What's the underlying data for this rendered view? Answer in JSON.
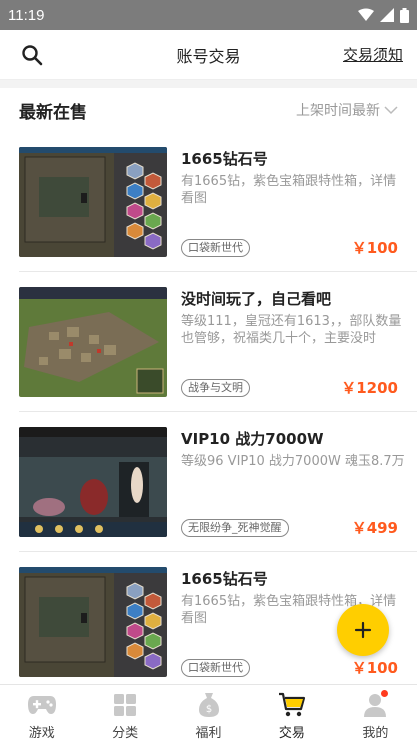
{
  "status_bar": {
    "time": "11:19"
  },
  "header": {
    "title": "账号交易",
    "rules_link": "交易须知"
  },
  "section": {
    "title": "最新在售",
    "sort_label": "上架时间最新"
  },
  "listings": [
    {
      "title": "1665钻石号",
      "description": "有1665钻，紫色宝箱跟特性箱，详情看图",
      "tag": "口袋新世代",
      "price": "￥100",
      "thumb": "hex"
    },
    {
      "title": "没时间玩了，自己看吧",
      "description": "等级111，皇冠还有1613，，部队数量也管够，祝福类几十个，主要没时",
      "tag": "战争与文明",
      "price": "￥1200",
      "thumb": "war"
    },
    {
      "title": "VIP10  战力7000W",
      "description": "等级96  VIP10  战力7000W  魂玉8.7万",
      "tag": "无限纷争_死神觉醒",
      "price": "￥499",
      "thumb": "anime"
    },
    {
      "title": "1665钻石号",
      "description": "有1665钻，紫色宝箱跟特性箱，详情看图",
      "tag": "口袋新世代",
      "price": "￥100",
      "thumb": "hex"
    }
  ],
  "tabs": [
    {
      "label": "游戏",
      "icon": "gamepad-icon",
      "active": false
    },
    {
      "label": "分类",
      "icon": "grid-icon",
      "active": false
    },
    {
      "label": "福利",
      "icon": "gift-bag-icon",
      "active": false
    },
    {
      "label": "交易",
      "icon": "cart-icon",
      "active": true
    },
    {
      "label": "我的",
      "icon": "person-icon",
      "active": false,
      "badge": true
    }
  ],
  "colors": {
    "price": "#ff5a1e",
    "fab": "#ffce00",
    "badge": "#ff3b1f"
  }
}
